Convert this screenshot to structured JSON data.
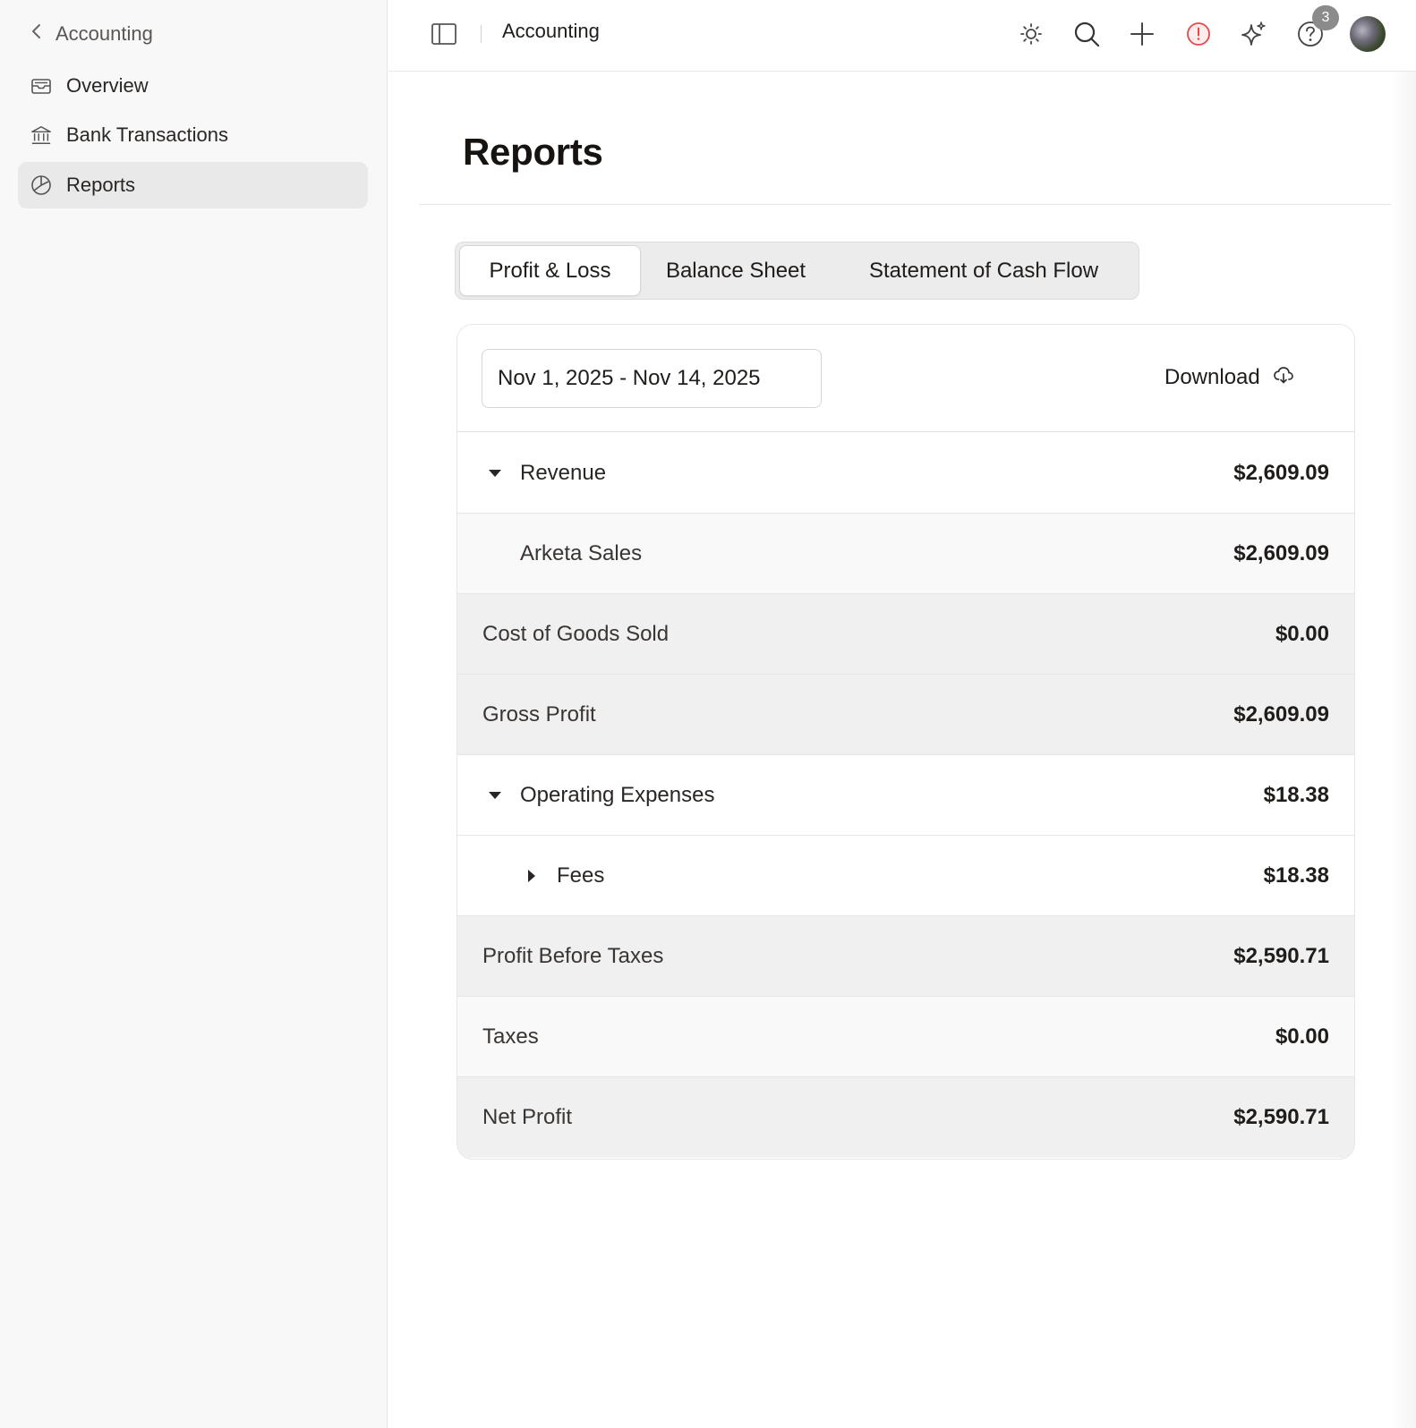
{
  "sidebar": {
    "back_label": "Accounting",
    "items": [
      {
        "label": "Overview",
        "icon": "inbox-icon"
      },
      {
        "label": "Bank Transactions",
        "icon": "bank-icon"
      },
      {
        "label": "Reports",
        "icon": "pie-chart-icon",
        "active": true
      }
    ]
  },
  "topbar": {
    "breadcrumb": "Accounting",
    "icons": [
      "sun-icon",
      "search-icon",
      "plus-icon",
      "alert-icon",
      "sparkle-icon",
      "help-icon"
    ],
    "help_badge": "3",
    "alert_color": "#e5484d"
  },
  "page": {
    "title": "Reports"
  },
  "tabs": [
    {
      "label": "Profit & Loss",
      "active": true
    },
    {
      "label": "Balance Sheet",
      "active": false
    },
    {
      "label": "Statement of Cash Flow",
      "active": false
    }
  ],
  "report": {
    "date_range": "Nov 1, 2025 - Nov 14, 2025",
    "download_label": "Download",
    "rows": [
      {
        "label": "Revenue",
        "amount": "$2,609.09",
        "caret": "down"
      },
      {
        "label": "Arketa Sales",
        "amount": "$2,609.09"
      },
      {
        "label": "Cost of Goods Sold",
        "amount": "$0.00"
      },
      {
        "label": "Gross Profit",
        "amount": "$2,609.09"
      },
      {
        "label": "Operating Expenses",
        "amount": "$18.38",
        "caret": "down"
      },
      {
        "label": "Fees",
        "amount": "$18.38",
        "caret": "right"
      },
      {
        "label": "Profit Before Taxes",
        "amount": "$2,590.71"
      },
      {
        "label": "Taxes",
        "amount": "$0.00"
      },
      {
        "label": "Net Profit",
        "amount": "$2,590.71"
      }
    ]
  }
}
